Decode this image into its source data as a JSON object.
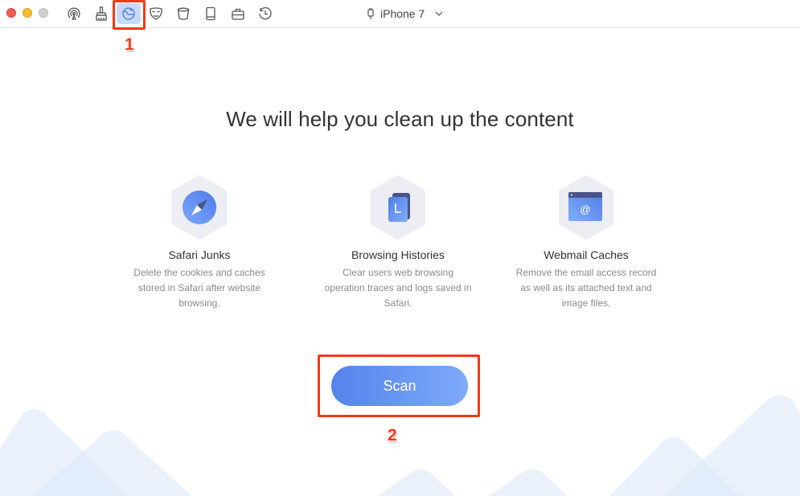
{
  "window": {
    "traffic_lights": [
      "close",
      "minimize",
      "maximize"
    ]
  },
  "toolbar": {
    "tools": [
      {
        "name": "airplay-icon",
        "active": false
      },
      {
        "name": "cleaner-brush-icon",
        "active": false
      },
      {
        "name": "browser-globe-icon",
        "active": true
      },
      {
        "name": "privacy-mask-icon",
        "active": false
      },
      {
        "name": "trash-bin-icon",
        "active": false
      },
      {
        "name": "phone-storage-icon",
        "active": false
      },
      {
        "name": "toolbox-briefcase-icon",
        "active": false
      },
      {
        "name": "history-clock-icon",
        "active": false
      }
    ],
    "device_icon": "phone-cable-icon",
    "device_name": "iPhone 7",
    "device_chevron": "chevron-down-icon"
  },
  "main": {
    "headline": "We will help you clean up the content",
    "features": [
      {
        "icon": "compass-icon",
        "title": "Safari Junks",
        "description": "Delete the cookies and caches stored in Safari after website browsing."
      },
      {
        "icon": "history-pages-icon",
        "title": "Browsing Histories",
        "description": "Clear users web browsing operation traces and logs saved in Safari."
      },
      {
        "icon": "webmail-at-icon",
        "title": "Webmail Caches",
        "description": "Remove the email access record as well as its attached text and image files."
      }
    ],
    "scan_label": "Scan"
  },
  "annotations": {
    "step1": "1",
    "step2": "2"
  },
  "colors": {
    "accent_start": "#5583ec",
    "accent_end": "#7eaaf9",
    "active_tool_bg": "#c8dafc",
    "annotation_red": "#f03a17",
    "hex_bg": "#eceef4",
    "mountain": "#e8f0fb"
  }
}
